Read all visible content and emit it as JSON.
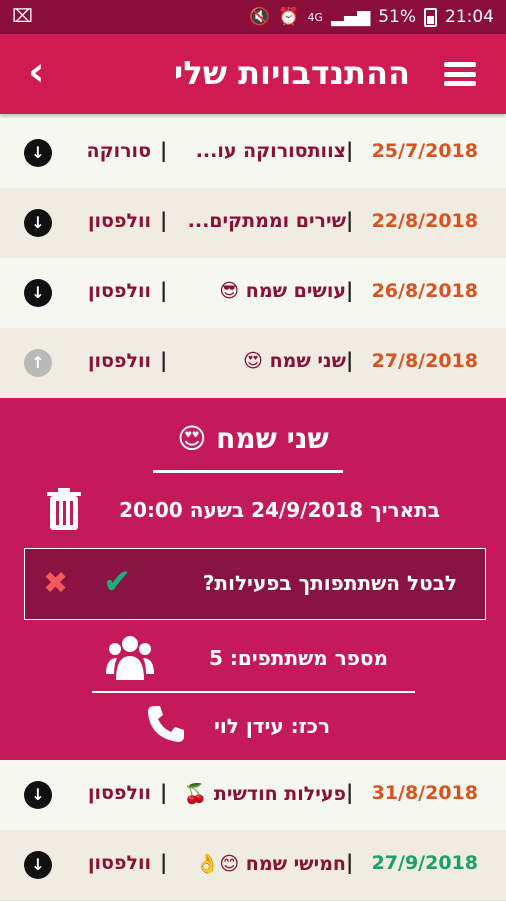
{
  "status": {
    "battery": "51%",
    "time": "21:04",
    "left_glyph": "⌧",
    "network": "4G"
  },
  "header": {
    "title": "ההתנדבויות שלי",
    "back_glyph": "‹"
  },
  "rows_top": [
    {
      "date": "25/7/2018",
      "name": "צוותסורוקה עו...",
      "place": "סורוקה",
      "date_color": "red",
      "arrow": "down",
      "bg": "light"
    },
    {
      "date": "22/8/2018",
      "name": "שירים וממתקים...",
      "place": "וולפסון",
      "date_color": "red",
      "arrow": "down",
      "bg": "beige"
    },
    {
      "date": "26/8/2018",
      "name": "עושים שמח 😎",
      "place": "וולפסון",
      "date_color": "red",
      "arrow": "down",
      "bg": "light"
    },
    {
      "date": "27/8/2018",
      "name": "שני שמח 😍",
      "place": "וולפסון",
      "date_color": "red",
      "arrow": "up",
      "bg": "beige"
    }
  ],
  "detail": {
    "title": "שני שמח 😍",
    "datetime": "בתאריך  24/9/2018 בשעה 20:00",
    "cancel_question": "לבטל השתתפותך בפעילות?",
    "participants": "מספר משתתפים:  5",
    "coordinator": "רכז:  עידן לוי"
  },
  "rows_bottom": [
    {
      "date": "31/8/2018",
      "name": "פעילות חודשית 🍒",
      "place": "וולפסון",
      "date_color": "red",
      "arrow": "down",
      "bg": "light"
    },
    {
      "date": "27/9/2018",
      "name": "חמישי שמח 😊👌",
      "place": "וולפסון",
      "date_color": "green",
      "arrow": "down",
      "bg": "beige"
    }
  ],
  "colors": {
    "primary": "#cf1b52",
    "statusbar": "#8a0d3a",
    "panel": "#c41a5c",
    "date_red": "#d9531e",
    "date_green": "#1aa06a"
  }
}
